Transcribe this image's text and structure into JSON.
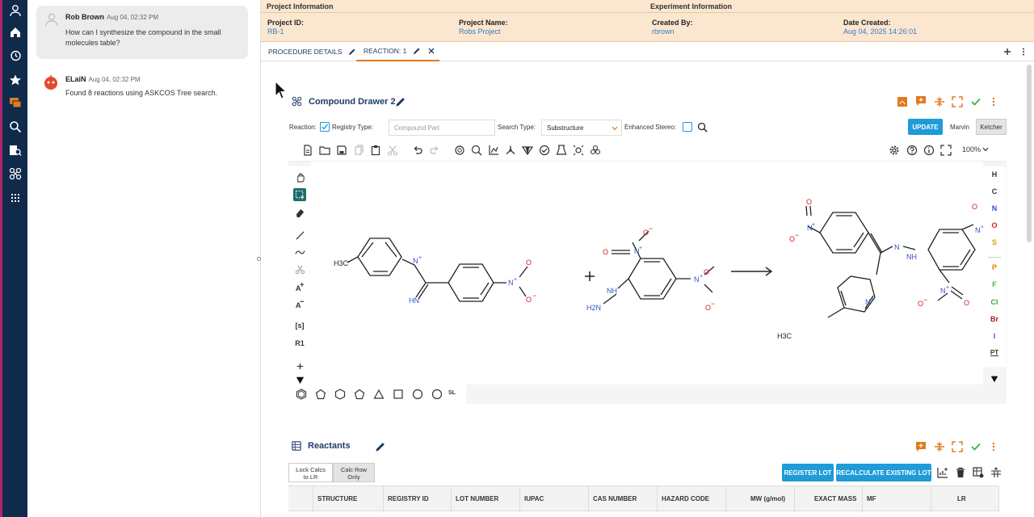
{
  "chat": {
    "messages": [
      {
        "author": "Rob Brown",
        "time": "Aug 04, 02:32 PM",
        "text_line1": "How can I synthesize the compound in the small",
        "text_line2": "molecules table?"
      },
      {
        "author": "ELaiN",
        "time": "Aug 04, 02:32 PM",
        "text_line1": "Found 8 reactions using ASKCOS Tree search."
      }
    ]
  },
  "info": {
    "project_header": "Project Information",
    "experiment_header": "Experiment Information",
    "project_id_label": "Project ID:",
    "project_id": "RB-1",
    "project_name_label": "Project Name:",
    "project_name": "Robs Project",
    "created_by_label": "Created By:",
    "created_by": "rbrown",
    "date_created_label": "Date Created:",
    "date_created": "Aug 04, 2025 14:26:01"
  },
  "tabs": [
    {
      "label": "PROCEDURE DETAILS"
    },
    {
      "label": "REACTION: 1"
    }
  ],
  "drawer": {
    "title": "Compound Drawer 2",
    "reaction_label": "Reaction:",
    "registry_type_label": "Registry Type:",
    "compound_part_placeholder": "Compound Part",
    "search_type_label": "Search Type:",
    "search_type_value": "Substructure",
    "enhanced_stereo_label": "Enhanced Stereo:",
    "update_label": "UPDATE",
    "marvin_label": "Marvin",
    "ketcher_label": "Ketcher",
    "zoom": "100%",
    "tool_labels": {
      "s_group": "[s]",
      "r_group": "R1",
      "ring_sl": "SL"
    },
    "atoms": [
      "H",
      "C",
      "N",
      "O",
      "S",
      "P",
      "F",
      "Cl",
      "Br",
      "I",
      "PT"
    ],
    "atom_colors": [
      "#333333",
      "#333333",
      "#3050c8",
      "#d42020",
      "#c8a020",
      "#e08000",
      "#50b050",
      "#30b030",
      "#a02020",
      "#8a2be2",
      "#333333"
    ]
  },
  "chem": {
    "h3c": "H3C",
    "n_plus": "N",
    "plus_sign": "+",
    "o": "O",
    "o_minus": "O",
    "minus": "−",
    "hn": "HN",
    "nh": "NH",
    "h2n": "H2N",
    "n": "N"
  },
  "reactants": {
    "title": "Reactants",
    "lock_calcs_line1": "Lock Calcs",
    "lock_calcs_line2": "to LR",
    "calc_row_line1": "Calc Row",
    "calc_row_line2": "Only",
    "register_lot": "REGISTER LOT",
    "recalc_lot": "RECALCULATE EXISTING LOT",
    "columns": [
      "STRUCTURE",
      "REGISTRY ID",
      "LOT NUMBER",
      "IUPAC",
      "CAS NUMBER",
      "HAZARD CODE",
      "MW (g/mol)",
      "EXACT MASS",
      "MF",
      "LR"
    ]
  },
  "colors": {
    "accent_orange": "#e27a1d",
    "navy": "#0f2a4a",
    "blue": "#1f9bd9",
    "green": "#3cae4a"
  }
}
